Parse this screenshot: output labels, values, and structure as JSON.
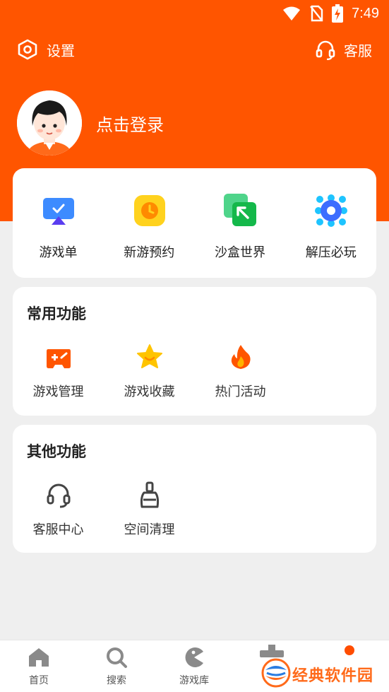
{
  "status_bar": {
    "time": "7:49"
  },
  "top_actions": {
    "settings_label": "设置",
    "service_label": "客服"
  },
  "profile": {
    "login_label": "点击登录"
  },
  "quick_links": [
    {
      "label": "游戏单",
      "icon": "game-list-icon"
    },
    {
      "label": "新游预约",
      "icon": "clock-icon"
    },
    {
      "label": "沙盒世界",
      "icon": "sandbox-icon"
    },
    {
      "label": "解压必玩",
      "icon": "dots-circle-icon"
    }
  ],
  "common_features": {
    "title": "常用功能",
    "items": [
      {
        "label": "游戏管理",
        "icon": "gamepad-icon"
      },
      {
        "label": "游戏收藏",
        "icon": "star-icon"
      },
      {
        "label": "热门活动",
        "icon": "flame-icon"
      }
    ]
  },
  "other_features": {
    "title": "其他功能",
    "items": [
      {
        "label": "客服中心",
        "icon": "headset-icon"
      },
      {
        "label": "空间清理",
        "icon": "broom-icon"
      }
    ]
  },
  "bottom_nav": [
    {
      "label": "首页",
      "icon": "home-icon"
    },
    {
      "label": "搜索",
      "icon": "search-icon"
    },
    {
      "label": "游戏库",
      "icon": "pacman-icon"
    }
  ],
  "watermark": {
    "text": "经典软件园"
  },
  "colors": {
    "accent": "#ff5500",
    "background": "#efefef"
  }
}
